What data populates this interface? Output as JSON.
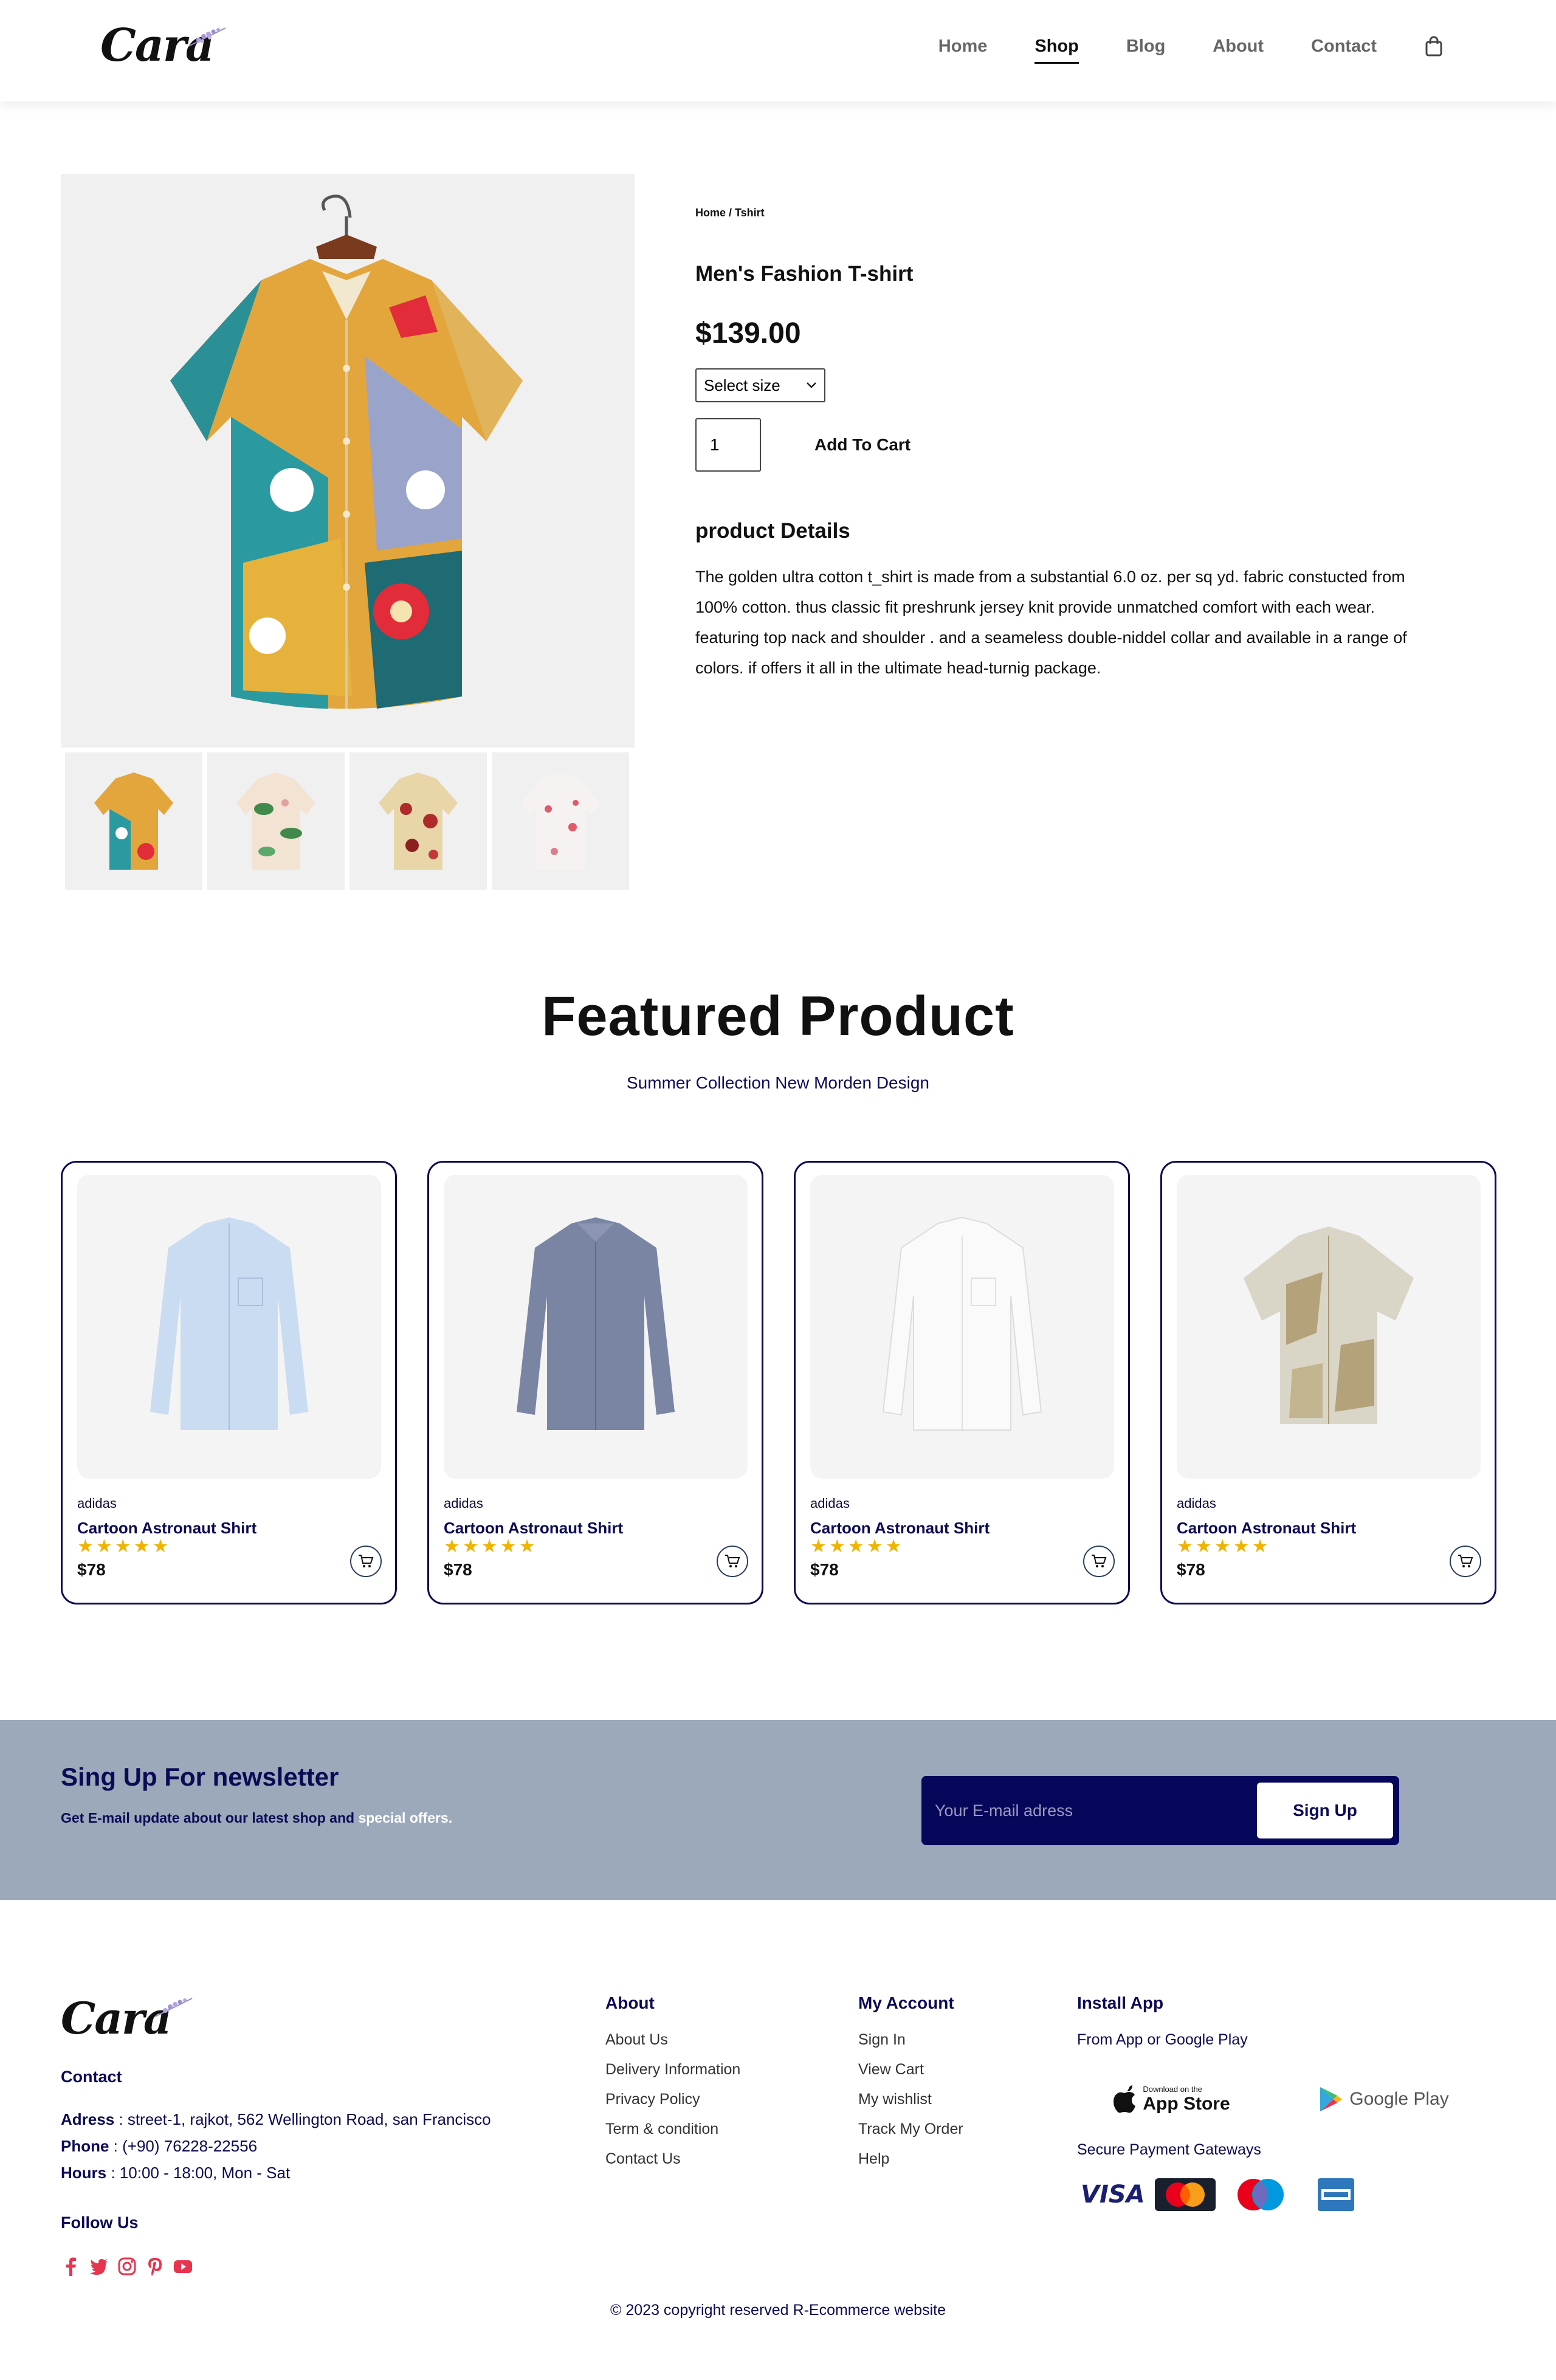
{
  "header": {
    "logo": "Cara",
    "nav": [
      "Home",
      "Shop",
      "Blog",
      "About",
      "Contact"
    ],
    "active_nav": "Shop",
    "cart_icon": "shopping-bag-icon"
  },
  "product": {
    "breadcrumb": "Home / Tshirt",
    "title": "Men's Fashion T-shirt",
    "price": "$139.00",
    "size_select": "Select size",
    "quantity": "1",
    "add_to_cart": "Add To Cart",
    "details_heading": "product Details",
    "details_text": "The golden ultra cotton t_shirt is made from a substantial 6.0 oz. per sq yd. fabric constucted from 100% cotton. thus classic fit preshrunk jersey knit provide unmatched comfort with each wear. featuring top nack and shoulder . and a seameless double-niddel collar and available in a range of colors. if offers it all in the ultimate head-turnig package."
  },
  "featured": {
    "title": "Featured Product",
    "subtitle": "Summer Collection New Morden Design",
    "products": [
      {
        "brand": "adidas",
        "name": "Cartoon Astronaut Shirt",
        "rating": 5,
        "price": "$78"
      },
      {
        "brand": "adidas",
        "name": "Cartoon Astronaut Shirt",
        "rating": 5,
        "price": "$78"
      },
      {
        "brand": "adidas",
        "name": "Cartoon Astronaut Shirt",
        "rating": 5,
        "price": "$78"
      },
      {
        "brand": "adidas",
        "name": "Cartoon Astronaut Shirt",
        "rating": 5,
        "price": "$78"
      }
    ]
  },
  "newsletter": {
    "title": "Sing Up For newsletter",
    "subtitle_main": "Get E-mail update about our latest shop and ",
    "subtitle_highlight": "special offers.",
    "placeholder": "Your E-mail adress",
    "button": "Sign Up"
  },
  "footer": {
    "logo": "Cara",
    "contact_heading": "Contact",
    "address_label": "Adress",
    "address": " : street-1, rajkot, 562 Wellington Road, san Francisco",
    "phone_label": "Phone",
    "phone": " : (+90) 76228-22556",
    "hours_label": "Hours",
    "hours": " : 10:00 - 18:00, Mon - Sat",
    "follow_heading": "Follow Us",
    "about_heading": "About",
    "about_links": [
      "About Us",
      "Delivery Information",
      "Privacy Policy",
      "Term & condition",
      "Contact Us"
    ],
    "account_heading": "My Account",
    "account_links": [
      "Sign In",
      "View Cart",
      "My wishlist",
      "Track My Order",
      "Help"
    ],
    "install_heading": "Install App",
    "install_sub": "From App or Google Play",
    "app_store_small": "Download on the",
    "app_store_big": "App Store",
    "google_play": "Google Play",
    "secure": "Secure Payment Gateways",
    "copyright": "© 2023 copyright reserved R-Ecommerce website"
  },
  "colors": {
    "navy": "#0b0b55",
    "star": "#f0b400",
    "newsletter_bg": "#9ca9bb",
    "social_red": "#e8344e"
  }
}
